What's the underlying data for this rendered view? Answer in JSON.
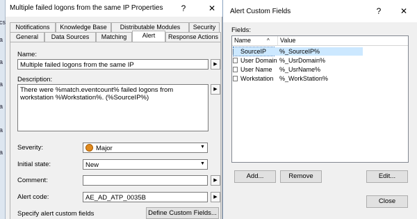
{
  "background_window": {
    "partial_text": [
      "cs",
      "a",
      "a",
      "a",
      "a",
      "a",
      "a"
    ]
  },
  "properties_dialog": {
    "title": "Multiple failed logons from the same IP Properties",
    "help_glyph": "?",
    "close_glyph": "✕",
    "tabs_row1": [
      "Notifications",
      "Knowledge Base",
      "Distributable Modules",
      "Security"
    ],
    "tabs_row2": [
      "General",
      "Data Sources",
      "Matching",
      "Alert",
      "Response Actions"
    ],
    "active_tab": "Alert",
    "name_label": "Name:",
    "name_value": "Multiple failed logons from the same IP",
    "description_label": "Description:",
    "description_line1": "There were %match.eventcount% failed logons from",
    "description_line2": "workstation %Workstation%. (%SourceIP%)",
    "severity_label": "Severity:",
    "severity_value": "Major",
    "initial_state_label": "Initial state:",
    "initial_state_value": "New",
    "comment_label": "Comment:",
    "comment_value": "",
    "alert_code_label": "Alert code:",
    "alert_code_value": "AE_AD_ATP_0035B",
    "custom_fields_label": "Specify alert custom fields",
    "define_button": "Define Custom Fields..."
  },
  "custom_fields_dialog": {
    "title": "Alert Custom Fields",
    "help_glyph": "?",
    "close_glyph": "✕",
    "fields_label": "Fields:",
    "col_name": "Name",
    "col_value": "Value",
    "sort_glyph": "^",
    "rows": [
      {
        "name": "SourceIP",
        "value": "%_SourceIP%"
      },
      {
        "name": "User Domain",
        "value": "%_UsrDomain%"
      },
      {
        "name": "User Name",
        "value": "%_UsrName%"
      },
      {
        "name": "Workstation",
        "value": "%_WorkStation%"
      }
    ],
    "selected_row": 0,
    "add_button": "Add...",
    "remove_button": "Remove",
    "edit_button": "Edit...",
    "close_button": "Close"
  }
}
